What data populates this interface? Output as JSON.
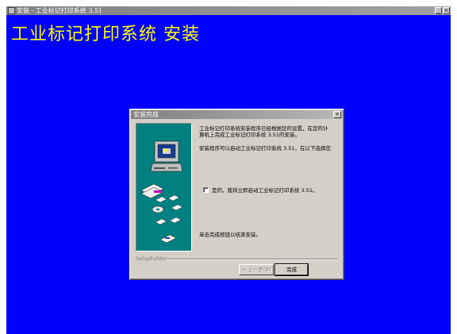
{
  "window": {
    "title": "安装 - 工业标记打印系统 3.51",
    "minimize_glyph": "_",
    "close_glyph": "×"
  },
  "heading": "工业标记打印系统 安装",
  "dialog": {
    "title": "安装完成",
    "close_glyph": "×",
    "message1_line1": "工业标记打印系统安装程序已经根据您的设置，在您的计",
    "message1_line2": "算机上完成工业标记打印系统 3.51的安装。",
    "message2": "安装程序可以启动工业标记打印系统 3.51，在以下选择您",
    "checkbox_label": "是的，我将立即启动工业标记打印系统 3.51。",
    "checkbox_checked": false,
    "finish_message": "单击完成按钮以结束安装。",
    "brand": "SetupBuilder",
    "back_button": "< 上一步(B)",
    "back_enabled": false,
    "finish_button": "完成"
  },
  "colors": {
    "desktop": "#0000ff",
    "heading": "#ffff00",
    "dialog_face": "#d4d0c8",
    "art_panel": "#008080"
  },
  "icons": [
    "computer-icon",
    "disk-icon",
    "cd-icon",
    "floppy-icon"
  ]
}
